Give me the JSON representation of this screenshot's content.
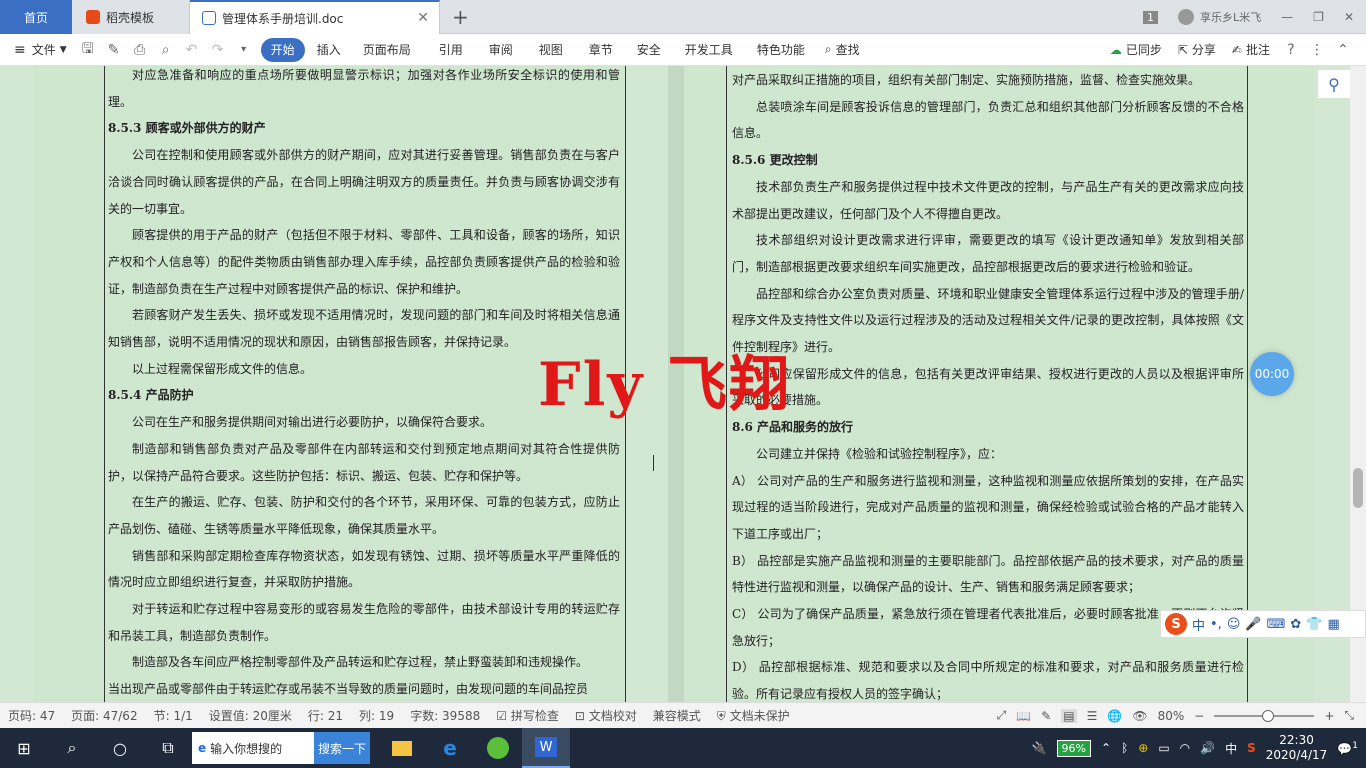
{
  "tabs": {
    "home": "首页",
    "template": "稻壳模板",
    "document": "管理体系手册培训.doc"
  },
  "window": {
    "page_badge": "1",
    "user": "享乐乡L米飞"
  },
  "menu": {
    "file": "文件",
    "items": [
      "开始",
      "插入",
      "页面布局",
      "引用",
      "审阅",
      "视图",
      "章节",
      "安全",
      "开发工具",
      "特色功能",
      "查找"
    ],
    "synced": "已同步",
    "share": "分享",
    "comment": "批注"
  },
  "left_page": [
    {
      "t": "p",
      "text": "对应急准备和响应的重点场所要做明显警示标识；加强对各作业场所安全标识的使用和管理。"
    },
    {
      "t": "hd",
      "text": "8.5.3  顾客或外部供方的财产"
    },
    {
      "t": "p",
      "text": "公司在控制和使用顾客或外部供方的财产期间，应对其进行妥善管理。销售部负责在与客户洽谈合同时确认顾客提供的产品，在合同上明确注明双方的质量责任。并负责与顾客协调交涉有关的一切事宜。"
    },
    {
      "t": "p",
      "text": "顾客提供的用于产品的财产（包括但不限于材料、零部件、工具和设备，顾客的场所，知识产权和个人信息等）的配件类物质由销售部办理入库手续，品控部负责顾客提供产品的检验和验证，制造部负责在生产过程中对顾客提供产品的标识、保护和维护。"
    },
    {
      "t": "p",
      "text": "若顾客财产发生丢失、损坏或发现不适用情况时，发现问题的部门和车间及时将相关信息通知销售部，说明不适用情况的现状和原因，由销售部报告顾客，并保持记录。"
    },
    {
      "t": "p",
      "text": "以上过程需保留形成文件的信息。"
    },
    {
      "t": "hd",
      "text": "8.5.4  产品防护"
    },
    {
      "t": "p",
      "text": "公司在生产和服务提供期间对输出进行必要防护，以确保符合要求。"
    },
    {
      "t": "p",
      "text": "制造部和销售部负责对产品及零部件在内部转运和交付到预定地点期间对其符合性提供防护，以保持产品符合要求。这些防护包括：标识、搬运、包装、贮存和保护等。"
    },
    {
      "t": "p",
      "text": "在生产的搬运、贮存、包装、防护和交付的各个环节，采用环保、可靠的包装方式，应防止产品划伤、磕碰、生锈等质量水平降低现象，确保其质量水平。"
    },
    {
      "t": "p",
      "text": "销售部和采购部定期检查库存物资状态，如发现有锈蚀、过期、损坏等质量水平严重降低的情况时应立即组织进行复查，并采取防护措施。"
    },
    {
      "t": "p",
      "text": "对于转运和贮存过程中容易变形的或容易发生危险的零部件，由技术部设计专用的转运贮存和吊装工具，制造部负责制作。"
    },
    {
      "t": "p",
      "text": "制造部及各车间应严格控制零部件及产品转运和贮存过程，禁止野蛮装卸和违规操作。"
    },
    {
      "t": "noind",
      "text": "当出现产品或零部件由于转运贮存或吊装不当导致的质量问题时，由发现问题的车间品控员"
    }
  ],
  "right_page": [
    {
      "t": "noind",
      "text": "对产品采取纠正措施的项目，组织有关部门制定、实施预防措施，监督、检查实施效果。"
    },
    {
      "t": "p",
      "text": "总装喷涂车间是顾客投诉信息的管理部门，负责汇总和组织其他部门分析顾客反馈的不合格信息。"
    },
    {
      "t": "hd",
      "text": "8.5.6  更改控制"
    },
    {
      "t": "p",
      "text": "技术部负责生产和服务提供过程中技术文件更改的控制，与产品生产有关的更改需求应向技术部提出更改建议，任何部门及个人不得擅自更改。"
    },
    {
      "t": "p",
      "text": "技术部组织对设计更改需求进行评审，需要更改的填写《设计更改通知单》发放到相关部门，制造部根据更改要求组织车间实施更改，品控部根据更改后的要求进行检验和验证。"
    },
    {
      "t": "p",
      "text": "品控部和综合办公室负责对质量、环境和职业健康安全管理体系运行过程中涉及的管理手册/程序文件及支持性文件以及运行过程涉及的活动及过程相关文件/记录的更改控制，具体按照《文件控制程序》进行。"
    },
    {
      "t": "p",
      "text": "公司应保留形成文件的信息，包括有关更改评审结果、授权进行更改的人员以及根据评审所采取的必要措施。"
    },
    {
      "t": "hd",
      "text": "8.6  产品和服务的放行"
    },
    {
      "t": "p",
      "text": "公司建立并保持《检验和试验控制程序》，应："
    },
    {
      "t": "noind",
      "text": "A）  公司对产品的生产和服务进行监视和测量，这种监视和测量应依据所策划的安排，在产品实现过程的适当阶段进行，完成对产品质量的监视和测量，确保经检验或试验合格的产品才能转入下道工序或出厂；"
    },
    {
      "t": "noind",
      "text": "B）  品控部是实施产品监视和测量的主要职能部门。品控部依据产品的技术要求，对产品的质量特性进行监视和测量，以确保产品的设计、生产、销售和服务满足顾客要求；"
    },
    {
      "t": "noind",
      "text": "C）  公司为了确保产品质量，紧急放行须在管理者代表批准后，必要时顾客批准，否则不允许紧急放行；"
    },
    {
      "t": "noind",
      "text": "D）  品控部根据标准、规范和要求以及合同中所规定的标准和要求，对产品和服务质量进行检验。所有记录应有授权人员的签字确认；"
    }
  ],
  "watermark": "Fly 飞翔",
  "timer": "00:00",
  "ime": {
    "lang": "中"
  },
  "statusbar": {
    "page_no": "页码: 47",
    "pages": "页面: 47/62",
    "section": "节: 1/1",
    "setting": "设置值: 20厘米",
    "row": "行: 21",
    "col": "列: 19",
    "words": "字数: 39588",
    "spell": "拼写检查",
    "proof": "文档校对",
    "compat": "兼容模式",
    "protect": "文档未保护",
    "zoom": "80%"
  },
  "taskbar": {
    "search_placeholder": "输入你想搜的",
    "search_button": "搜索一下",
    "battery": "96%",
    "ime_lang": "中",
    "time": "22:30",
    "date": "2020/4/17",
    "notifications": "1"
  }
}
